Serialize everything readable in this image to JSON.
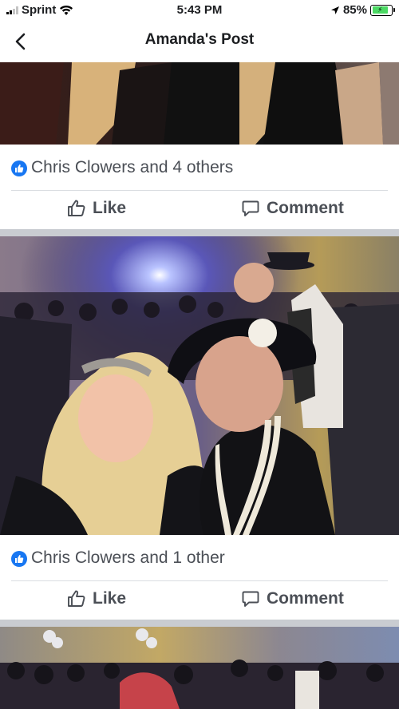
{
  "status_bar": {
    "carrier": "Sprint",
    "time": "5:43 PM",
    "battery_percent": "85%",
    "battery_level": 0.85,
    "icons": [
      "signal-icon",
      "wifi-icon",
      "location-icon",
      "battery-icon"
    ]
  },
  "header": {
    "title": "Amanda's Post",
    "back_icon": "chevron-left-icon"
  },
  "posts": [
    {
      "reaction_summary": "Chris Clowers and 4 others",
      "like_label": "Like",
      "comment_label": "Comment"
    },
    {
      "reaction_summary": "Chris Clowers and 1 other",
      "like_label": "Like",
      "comment_label": "Comment"
    }
  ],
  "colors": {
    "facebook_blue": "#1877f2",
    "action_text": "#4b4f56",
    "separator": "#c9ccd1",
    "battery_fill": "#4cd964"
  }
}
